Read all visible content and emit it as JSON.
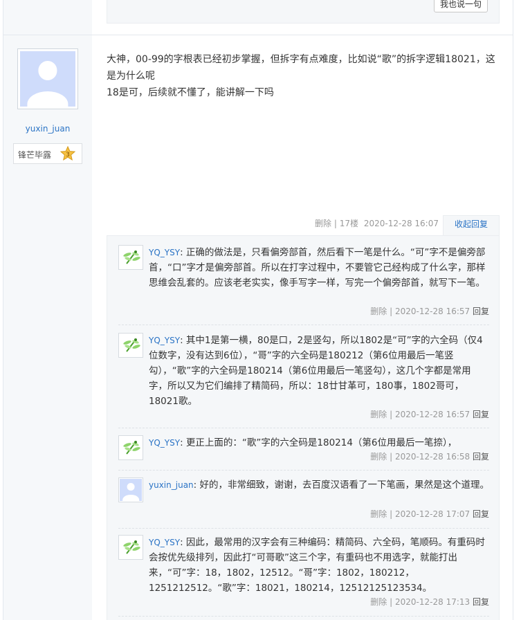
{
  "top": {
    "say_button": "我也说一句"
  },
  "author": {
    "name": "yuxin_juan",
    "badge_label": "锋芒毕露",
    "badge_level": "3"
  },
  "post": {
    "line1": "大神，00-99的字根表已经初步掌握，但拆字有点难度，比如说“歌”的拆字逻辑18021，这是为什么呢",
    "line2": "18是可，后续就不懂了，能讲解一下吗",
    "meta_delete": "删除",
    "meta_sep": "|",
    "floor": "17楼",
    "time": "2020-12-28 16:07",
    "collapse_label": "收起回复"
  },
  "replies": [
    {
      "user": "YQ_YSY",
      "avatar": "dragonfly-icon",
      "text": ": 正确的做法是，只看偏旁部首，然后看下一笔是什么。“可”字不是偏旁部首，“口”字才是偏旁部首。所以在打字过程中，不要管它己经构成了什么字，那样思维会乱套的。应该老老实实，像手写字一样，写完一个偏旁部首，就写下一笔。",
      "delete": "删除",
      "sep": "|",
      "time": "2020-12-28 16:57",
      "reply": "回复"
    },
    {
      "user": "YQ_YSY",
      "avatar": "dragonfly-icon",
      "text": ": 其中1是第一横，80是口，2是竖勾，所以1802是“可”字的六全码（仅4位数字，没有达到6位），“哥”字的六全码是180212（第6位用最后一笔竖勾），“歌”字的六全码是180214（第6位用最后一笔竖勾），这几个字都是常用字，所以又为它们编排了精简码，所以：18廿甘革可，180事，1802哥可，18021歌。",
      "delete": "删除",
      "sep": "|",
      "time": "2020-12-28 16:57",
      "reply": "回复"
    },
    {
      "user": "YQ_YSY",
      "avatar": "dragonfly-icon",
      "text": ": 更正上面的：“歌”字的六全码是180214（第6位用最后一笔捺），",
      "delete": "删除",
      "sep": "|",
      "time": "2020-12-28 16:58",
      "reply": "回复"
    },
    {
      "user": "yuxin_juan",
      "avatar": "default-avatar-icon",
      "text": ": 好的，非常细致，谢谢，去百度汉语看了一下笔画，果然是这个道理。",
      "delete": "删除",
      "sep": "|",
      "time": "2020-12-28 17:07",
      "reply": "回复"
    },
    {
      "user": "YQ_YSY",
      "avatar": "dragonfly-icon",
      "text": ": 因此，最常用的汉字会有三种编码：精简码、六全码，笔顺码。有重码时会按优先级排列，因此打“可哥歌”这三个字，有重码也不用选字，就能打出来，“可”字：18，1802，12512。“哥”字：1802，180212，1251212512。“歌”字：18021，180214，12512125123534。",
      "delete": "删除",
      "sep": "|",
      "time": "2020-12-28 17:13",
      "reply": "回复"
    }
  ]
}
